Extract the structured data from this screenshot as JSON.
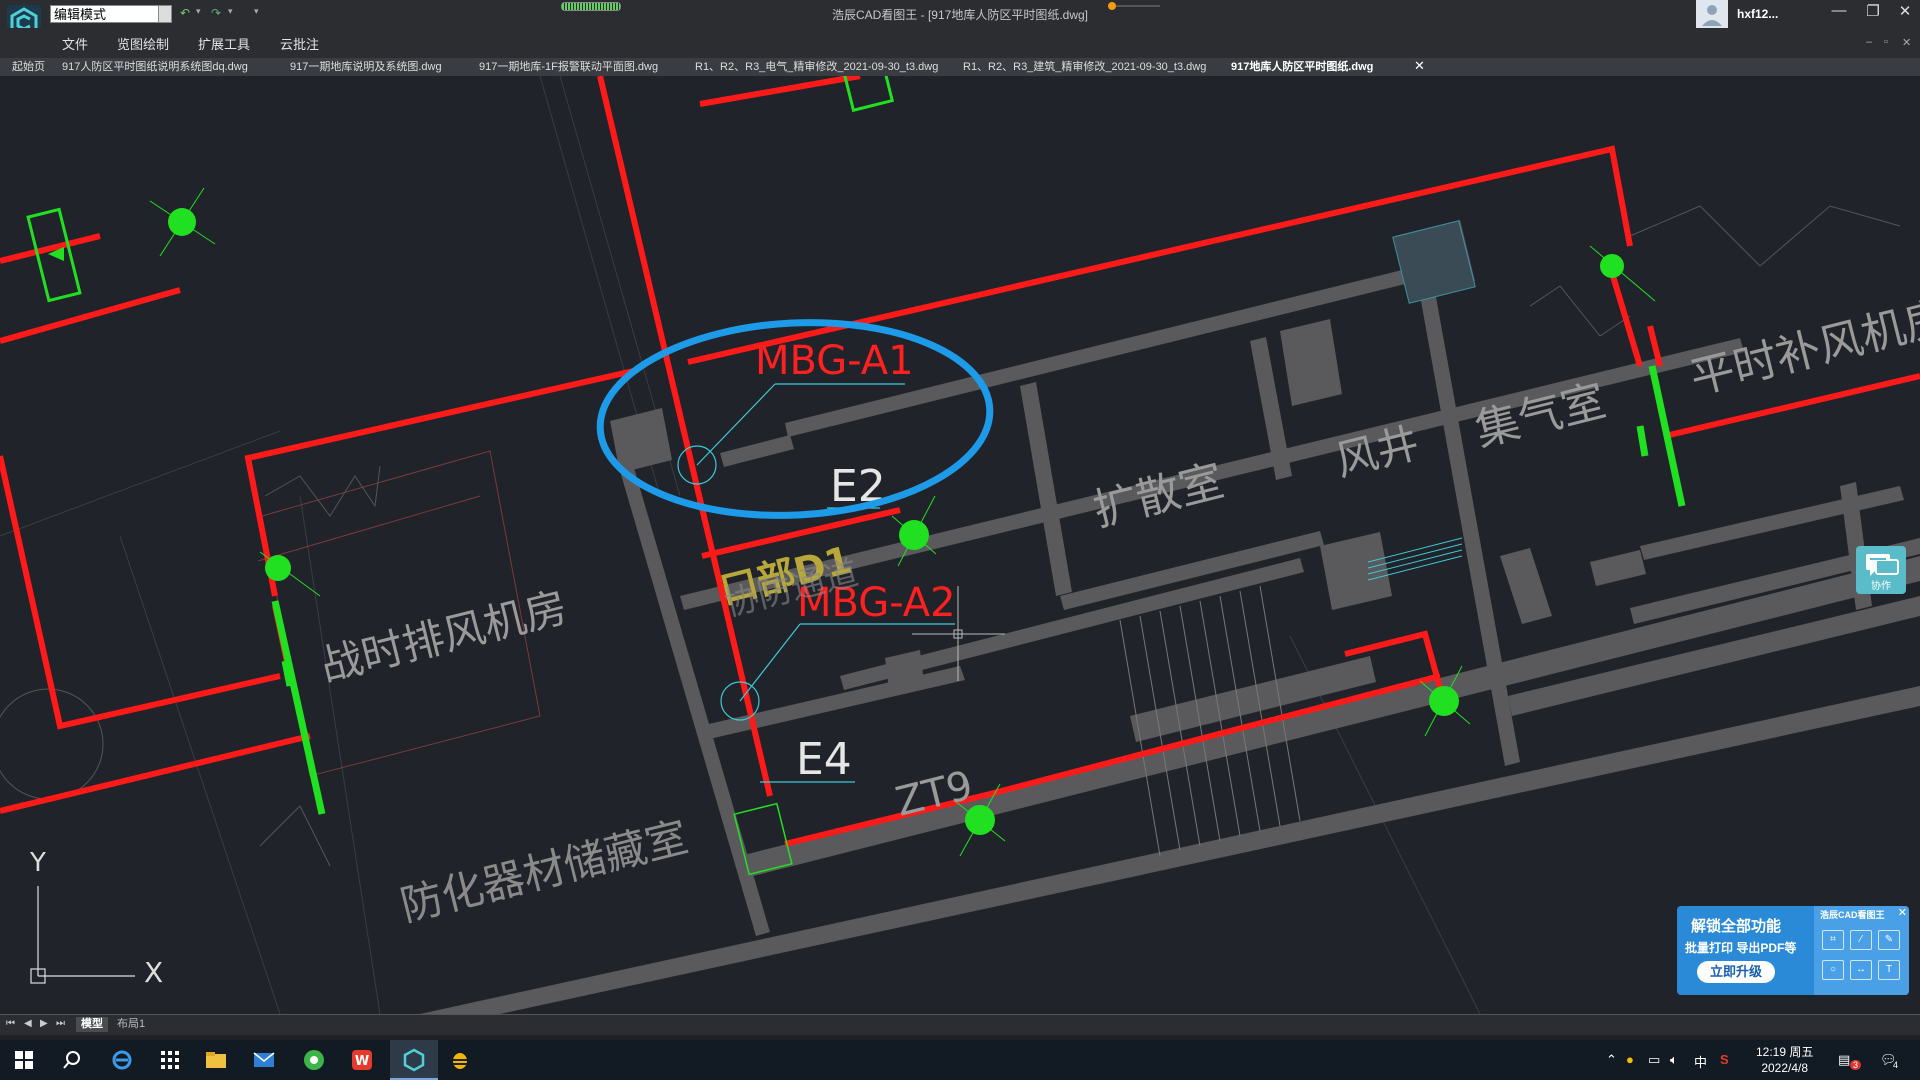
{
  "titlebar": {
    "mode": "编辑模式",
    "title": "浩辰CAD看图王 - [917地库人防区平时图纸.dwg]",
    "user": "hxf12..."
  },
  "menu": [
    "文件",
    "览图绘制",
    "扩展工具",
    "云批注"
  ],
  "tabs": [
    "起始页",
    "917人防区平时图纸说明系统图dq.dwg",
    "917一期地库说明及系统图.dwg",
    "917一期地库-1F报警联动平面图.dwg",
    "R1、R2、R3_电气_精审修改_2021-09-30_t3.dwg",
    "R1、R2、R3_建筑_精审修改_2021-09-30_t3.dwg",
    "917地库人防区平时图纸.dwg"
  ],
  "drawing": {
    "rooms": {
      "exhaust_room": "战时排风机房",
      "storage": "防化器材储藏室",
      "diffusion": "扩散室",
      "shaft": "风井",
      "plenum": "集气室",
      "supply_room": "平时补风机房",
      "passage": "协防通道"
    },
    "labels": {
      "mbg_a1": "MBG-A1",
      "mbg_a2": "MBG-A2",
      "e2": "E2",
      "e4": "E4",
      "zt9": "ZT9",
      "entrance": "口部D1",
      "axis_y": "Y",
      "axis_x": "X"
    }
  },
  "collab": {
    "label": "协作"
  },
  "promo": {
    "title": "解锁全部功能",
    "subtitle": "批量打印 导出PDF等",
    "button": "立即升级",
    "brand": "浩辰CAD看图王"
  },
  "layout_tabs": [
    "模型",
    "布局1"
  ],
  "taskbar": {
    "time": "12:19 周五",
    "date": "2022/4/8",
    "ime": "中",
    "notifications": "3",
    "chat_badge": "4"
  },
  "colors": {
    "wire": "#ff1a1a",
    "device": "#21e021",
    "wall": "#5a5a5c",
    "highlight": "#1e9be8",
    "annotation": "#3ec8d8"
  }
}
